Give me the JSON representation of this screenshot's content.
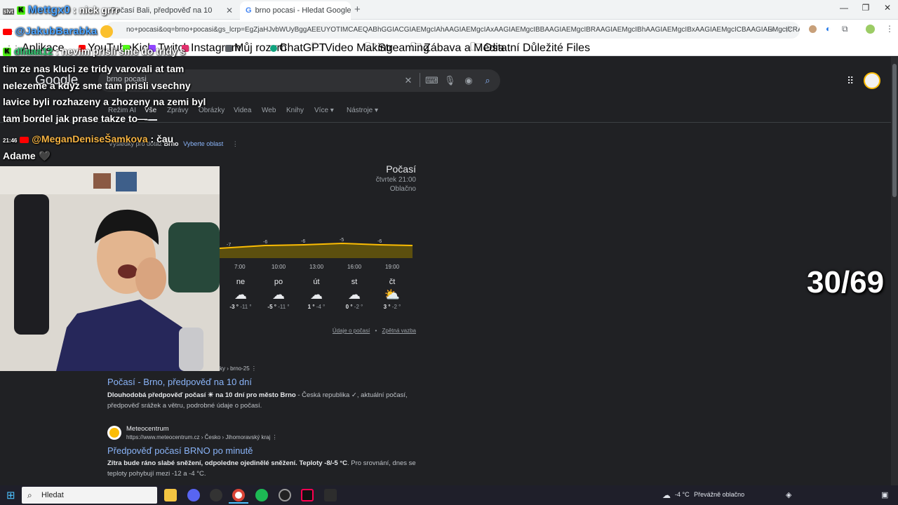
{
  "browser": {
    "tabs": [
      {
        "label": "Počasí Bali, předpověď na 10"
      },
      {
        "label": "brno pocasi - Hledat Googlem"
      }
    ],
    "new_tab": "+",
    "url": "no+pocasi&oq=brno+pocasi&gs_lcrp=EgZjaHJvbWUyBggAEEUYOTIMCAEQABhGGIACGIAEMgcIAhAAGIAEMgcIAxAAGIAEMgcIBBAAGIAEMgcIBRAAGIAEMgcIBhAAGIAEMgcIBxAAGIAEMgcICBAAGIAEMgcICRAAGI...",
    "bookmarks": [
      "Aplikace",
      "YouTube",
      "Kick",
      "Twitch",
      "Instagram",
      "Můj rozvrh",
      "ChatGPT",
      "Video Making",
      "Streaming",
      "Zábava a Média",
      "Ostatní Důležité Files"
    ]
  },
  "google": {
    "logo": "Google",
    "query": "brno pocasi",
    "nav": [
      "Režim AI",
      "Vše",
      "Zprávy",
      "Obrázky",
      "Videa",
      "Web",
      "Knihy",
      "Více",
      "Nástroje"
    ],
    "results_for_prefix": "Výsledky pro dotaz",
    "results_for_place": "Brno",
    "choose_area": "Vyberte oblast",
    "weather": {
      "title": "Počasí",
      "time": "čtvrtek 21:00",
      "condition": "Oblačno",
      "hourly_labels": [
        "-7",
        "-6",
        "-6",
        "-5",
        "-6"
      ],
      "hours": [
        "7:00",
        "10:00",
        "13:00",
        "16:00",
        "19:00"
      ],
      "days": [
        {
          "day": "ne",
          "high": "-3 °",
          "low": "-11 °",
          "icon": "cloud-icon"
        },
        {
          "day": "po",
          "high": "-5 °",
          "low": "-11 °",
          "icon": "cloud-icon"
        },
        {
          "day": "út",
          "high": "1 °",
          "low": "-4 °",
          "icon": "cloud-icon"
        },
        {
          "day": "st",
          "high": "0 °",
          "low": "-2 °",
          "icon": "cloud-icon"
        },
        {
          "day": "čt",
          "high": "3 °",
          "low": "-2 °",
          "icon": "partly-sunny-icon"
        }
      ],
      "data_link": "Údaje o počasí",
      "feedback_link": "Zpětná vazba"
    },
    "results": [
      {
        "crumb": "ky › brno-25",
        "title": "Počasí - Brno, předpověď na 10 dní",
        "desc_bold": "Dlouhodobá předpověď počasí ☀ na 10 dní pro město Brno",
        "desc_rest": " - Česká republika ✓, aktuální počasí, předpověď srážek a větru, podrobné údaje o počasí."
      },
      {
        "site": "Meteocentrum",
        "crumb": "https://www.meteocentrum.cz › Česko › Jihomoravský kraj",
        "title": "Předpověď počasí BRNO po minutě",
        "desc_bold": "Zítra bude ráno slabé sněžení, odpoledne ojedinělé sněžení. Teploty -8/-5 °C",
        "desc_rest": ". Pro srovnání, dnes se teploty pohybují mezi -12 a -4 °C."
      }
    ]
  },
  "chat": {
    "msg1_user": "Mettgx0",
    "msg1_text": ": nick grrr",
    "msg2_user": "@JakubBarabka",
    "msg3_user": "dliaaa12",
    "msg3_text": ": nevim prisli sme do tridy s",
    "line4": "tim ze nas kluci ze tridy varovali at tam",
    "line5": "nelezeme a kdyz sme tam prisli vsechny",
    "line6": "lavice byli rozhazeny a zhozeny na zemi byl",
    "line7": "tam bordel jak prase takze to—",
    "msg4_time": "21:46",
    "msg4_user": "@MeganDeniseŠamkova",
    "msg4_text": ": čau",
    "line9": "Adame 🖤"
  },
  "overlay_counter": "30/69",
  "taskbar": {
    "search_label": "Hledat",
    "weather_temp": "-4 °C",
    "weather_text": "Převážně oblačno"
  },
  "colors": {
    "page_bg": "#202124",
    "link": "#8ab4f8",
    "chart_fill": "#5c4f0e",
    "chart_line": "#fbbc04"
  }
}
